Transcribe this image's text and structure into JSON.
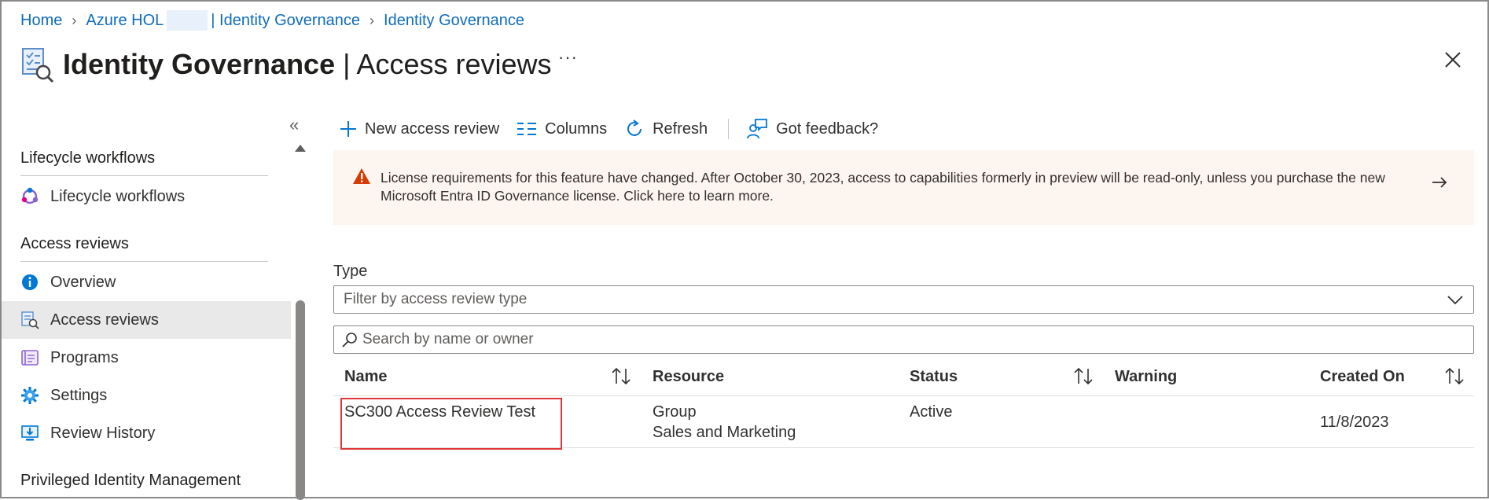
{
  "breadcrumb": {
    "items": [
      "Home",
      "Azure HOL",
      "| Identity Governance",
      "Identity Governance"
    ]
  },
  "header": {
    "title_main": "Identity Governance",
    "title_sep": " | ",
    "title_sub": "Access reviews",
    "more": "···",
    "icon": "access-review-icon",
    "close_icon": "close-icon"
  },
  "sidebar": {
    "collapse_glyph": "«",
    "sections": [
      {
        "title": "Lifecycle workflows",
        "items": [
          {
            "label": "Lifecycle workflows",
            "icon": "lifecycle-icon"
          }
        ]
      },
      {
        "title": "Access reviews",
        "items": [
          {
            "label": "Overview",
            "icon": "info-icon"
          },
          {
            "label": "Access reviews",
            "icon": "access-review-icon",
            "selected": true
          },
          {
            "label": "Programs",
            "icon": "programs-icon"
          },
          {
            "label": "Settings",
            "icon": "gear-icon"
          },
          {
            "label": "Review History",
            "icon": "monitor-download-icon"
          }
        ]
      },
      {
        "title": "Privileged Identity Management",
        "items": []
      }
    ]
  },
  "toolbar": {
    "new_label": "New access review",
    "columns_label": "Columns",
    "refresh_label": "Refresh",
    "feedback_label": "Got feedback?"
  },
  "banner": {
    "message": "License requirements for this feature have changed. After October 30, 2023, access to capabilities formerly in preview will be read-only, unless you purchase the new Microsoft Entra ID Governance license. Click here to learn more.",
    "color": "#fdf5ef",
    "warning_color": "#d83b01"
  },
  "filters": {
    "type_label": "Type",
    "type_placeholder": "Filter by access review type",
    "search_placeholder": "Search by name or owner"
  },
  "table": {
    "columns": [
      "Name",
      "Resource",
      "Status",
      "Warning",
      "Created On"
    ],
    "rows": [
      {
        "name": "SC300 Access Review Test",
        "resource_type": "Group",
        "resource_name": "Sales and Marketing",
        "status": "Active",
        "warning": "",
        "created_on": "11/8/2023"
      }
    ]
  },
  "colors": {
    "link": "#0f6cbd",
    "accent": "#0078d4",
    "highlight_border": "#e0363a"
  }
}
